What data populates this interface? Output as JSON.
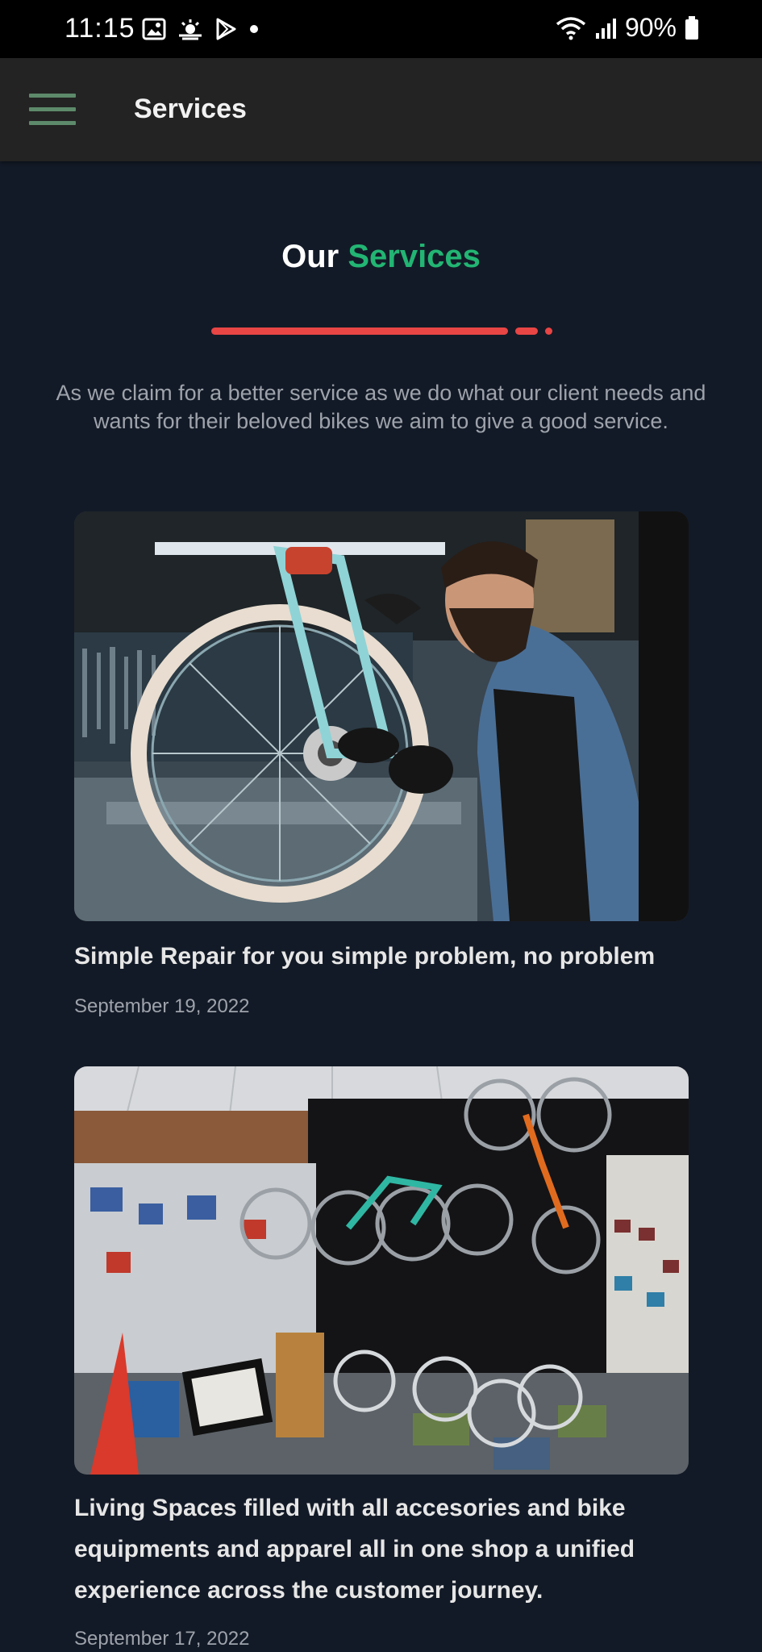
{
  "status_bar": {
    "time": "11:15",
    "battery": "90%",
    "icons": [
      "gallery-icon",
      "weather-icon",
      "play-store-icon",
      "dot-icon",
      "wifi-icon",
      "signal-icon",
      "battery-icon"
    ]
  },
  "app_bar": {
    "title": "Services",
    "menu_icon": "hamburger-menu-icon"
  },
  "section": {
    "heading_prefix": "Our",
    "heading_accent": "Services",
    "intro": "As we claim for a better service as we do what our client needs and wants for their beloved bikes we aim to give a good service."
  },
  "colors": {
    "background": "#131a27",
    "app_bar": "#232323",
    "accent_green": "#22b573",
    "divider_red": "#e84545",
    "menu_icon": "#5d8a6a"
  },
  "services": [
    {
      "title": "Simple Repair for you simple problem, no problem",
      "date": "September 19, 2022",
      "image": "bike-mechanic-photo"
    },
    {
      "title": "Living Spaces filled with all accesories and bike equipments and apparel all in one shop a unified experience across the customer journey.",
      "date": "September 17, 2022",
      "image": "bike-shop-photo"
    }
  ]
}
